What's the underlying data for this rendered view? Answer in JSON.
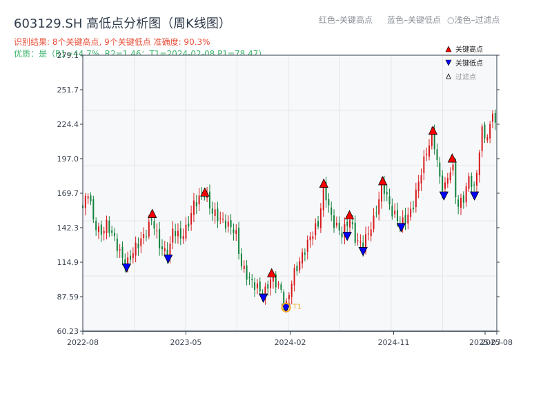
{
  "chart_data": {
    "type": "candlestick",
    "title": "603129.SH 高低点分析图（周K线图）",
    "subtitle_result": "识别结果: 8个关键高点, 9个关键低点   准确度: 90.3%",
    "subtitle_quality": "优质：是（R1=44.7%, R2=1.46；T1=2024-02-08 P1=78.47）",
    "hints": [
      "红色–关键高点",
      "蓝色–关键低点",
      "○浅色–过滤点"
    ],
    "legend": {
      "placement": "top-right",
      "entries": [
        "关键高点",
        "关键低点",
        "过滤点"
      ]
    },
    "colors": {
      "up": "#d7191c",
      "down": "#11823b",
      "high_marker": "#ff0000",
      "low_marker": "#0000ff",
      "t1": "#f5a623",
      "grid": "#e3e6ea",
      "plot_bg": "#f7f8fa"
    },
    "ylim": [
      60.23,
      279.1
    ],
    "yticks": [
      "279.1",
      "251.7",
      "224.4",
      "197.0",
      "169.7",
      "142.3",
      "114.9",
      "87.59",
      "60.23"
    ],
    "xlim": [
      "2022-08-01",
      "2025-08-01"
    ],
    "xticks": [
      {
        "label": "2022-08",
        "date": "2022-08-01"
      },
      {
        "label": "2023-05",
        "date": "2023-05-01"
      },
      {
        "label": "2024-02",
        "date": "2024-02-01"
      },
      {
        "label": "2024-11",
        "date": "2024-11-01"
      },
      {
        "label": "2025-07",
        "date": "2025-07-01"
      },
      {
        "label": "2025-08",
        "date": "2025-08-01"
      }
    ],
    "grid": true,
    "close_path": [
      [
        "2022-08-01",
        158
      ],
      [
        "2022-08-16",
        172
      ],
      [
        "2022-08-29",
        148
      ],
      [
        "2022-09-16",
        137
      ],
      [
        "2022-10-04",
        145
      ],
      [
        "2022-10-23",
        134
      ],
      [
        "2022-11-10",
        120
      ],
      [
        "2022-11-25",
        113
      ],
      [
        "2022-12-17",
        126
      ],
      [
        "2023-01-13",
        137
      ],
      [
        "2023-02-01",
        150
      ],
      [
        "2023-02-19",
        129
      ],
      [
        "2023-03-15",
        119
      ],
      [
        "2023-03-28",
        142
      ],
      [
        "2023-04-15",
        134
      ],
      [
        "2023-05-04",
        142
      ],
      [
        "2023-05-22",
        161
      ],
      [
        "2023-06-20",
        170
      ],
      [
        "2023-07-07",
        156
      ],
      [
        "2023-08-03",
        148
      ],
      [
        "2023-09-09",
        140
      ],
      [
        "2023-09-24",
        113
      ],
      [
        "2023-10-16",
        101
      ],
      [
        "2023-11-12",
        93
      ],
      [
        "2023-11-22",
        88
      ],
      [
        "2023-12-14",
        104
      ],
      [
        "2024-01-07",
        93
      ],
      [
        "2024-01-21",
        79
      ],
      [
        "2024-02-08",
        104
      ],
      [
        "2024-03-01",
        118
      ],
      [
        "2024-03-28",
        137
      ],
      [
        "2024-04-15",
        145
      ],
      [
        "2024-04-30",
        175
      ],
      [
        "2024-05-22",
        148
      ],
      [
        "2024-06-18",
        137
      ],
      [
        "2024-07-07",
        150
      ],
      [
        "2024-07-25",
        131
      ],
      [
        "2024-08-12",
        129
      ],
      [
        "2024-09-09",
        148
      ],
      [
        "2024-10-03",
        177
      ],
      [
        "2024-10-25",
        156
      ],
      [
        "2024-11-21",
        145
      ],
      [
        "2024-12-19",
        156
      ],
      [
        "2025-01-12",
        186
      ],
      [
        "2025-01-29",
        205
      ],
      [
        "2025-02-13",
        216
      ],
      [
        "2025-03-03",
        181
      ],
      [
        "2025-03-14",
        172
      ],
      [
        "2025-04-05",
        194
      ],
      [
        "2025-04-18",
        158
      ],
      [
        "2025-05-07",
        167
      ],
      [
        "2025-05-20",
        183
      ],
      [
        "2025-06-03",
        172
      ],
      [
        "2025-06-22",
        219
      ],
      [
        "2025-07-10",
        213
      ],
      [
        "2025-07-23",
        241
      ],
      [
        "2025-07-30",
        216
      ],
      [
        "2025-08-01",
        257
      ]
    ],
    "key_highs": [
      [
        "2023-02-01",
        153
      ],
      [
        "2023-06-20",
        170
      ],
      [
        "2023-12-14",
        106
      ],
      [
        "2024-04-30",
        177
      ],
      [
        "2024-07-07",
        152
      ],
      [
        "2024-10-03",
        179
      ],
      [
        "2025-02-13",
        219
      ],
      [
        "2025-04-05",
        197
      ]
    ],
    "key_lows": [
      [
        "2022-11-25",
        111
      ],
      [
        "2023-03-15",
        118
      ],
      [
        "2023-11-22",
        87
      ],
      [
        "2024-01-21",
        79
      ],
      [
        "2024-07-01",
        136
      ],
      [
        "2024-08-12",
        124
      ],
      [
        "2024-11-21",
        143
      ],
      [
        "2025-03-14",
        168
      ],
      [
        "2025-06-03",
        168
      ]
    ],
    "t1": {
      "label": "T1",
      "date": "2024-01-21",
      "value": 78.47
    }
  }
}
